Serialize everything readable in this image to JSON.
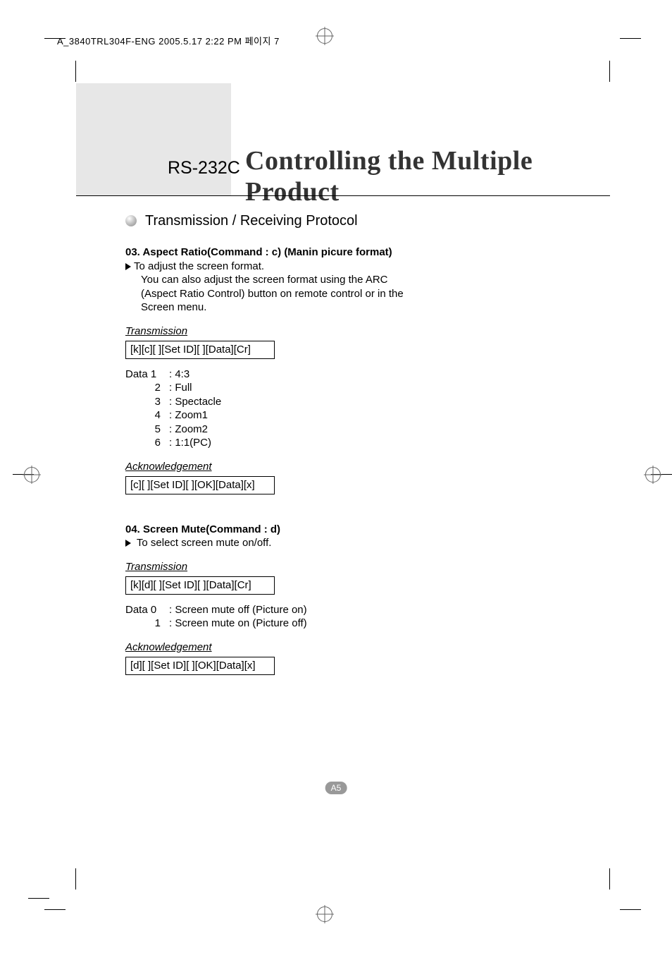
{
  "print_meta": "A_3840TRL304F-ENG  2005.5.17  2:22 PM  페이지 7",
  "banner": {
    "rs": "RS-232C",
    "title": "Controlling the Multiple Product"
  },
  "section_heading": "Transmission / Receiving Protocol",
  "cmd03": {
    "title": "03. Aspect Ratio(Command : c) (Manin picure format)",
    "desc1": "To adjust the screen format.",
    "desc2": "You can also adjust the screen format using the ARC",
    "desc3": "(Aspect Ratio Control) button on remote control or in the",
    "desc4": "Screen menu.",
    "trans_label": "Transmission",
    "trans_code": "[k][c][ ][Set ID][ ][Data][Cr]",
    "data": [
      {
        "label": "Data 1",
        "text": ": 4:3"
      },
      {
        "label": "2",
        "text": ": Full"
      },
      {
        "label": "3",
        "text": ": Spectacle"
      },
      {
        "label": "4",
        "text": ": Zoom1"
      },
      {
        "label": "5",
        "text": ": Zoom2"
      },
      {
        "label": "6",
        "text": ": 1:1(PC)"
      }
    ],
    "ack_label": "Acknowledgement",
    "ack_code": "[c][ ][Set ID][ ][OK][Data][x]"
  },
  "cmd04": {
    "title": "04. Screen Mute(Command : d)",
    "desc1": "To select screen mute on/off.",
    "trans_label": "Transmission",
    "trans_code": "[k][d][ ][Set ID][ ][Data][Cr]",
    "data": [
      {
        "label": "Data 0",
        "text": ": Screen mute off (Picture on)"
      },
      {
        "label": "1",
        "text": ": Screen mute on (Picture off)"
      }
    ],
    "ack_label": "Acknowledgement",
    "ack_code": "[d][ ][Set ID][ ][OK][Data][x]"
  },
  "page_number": "A5"
}
